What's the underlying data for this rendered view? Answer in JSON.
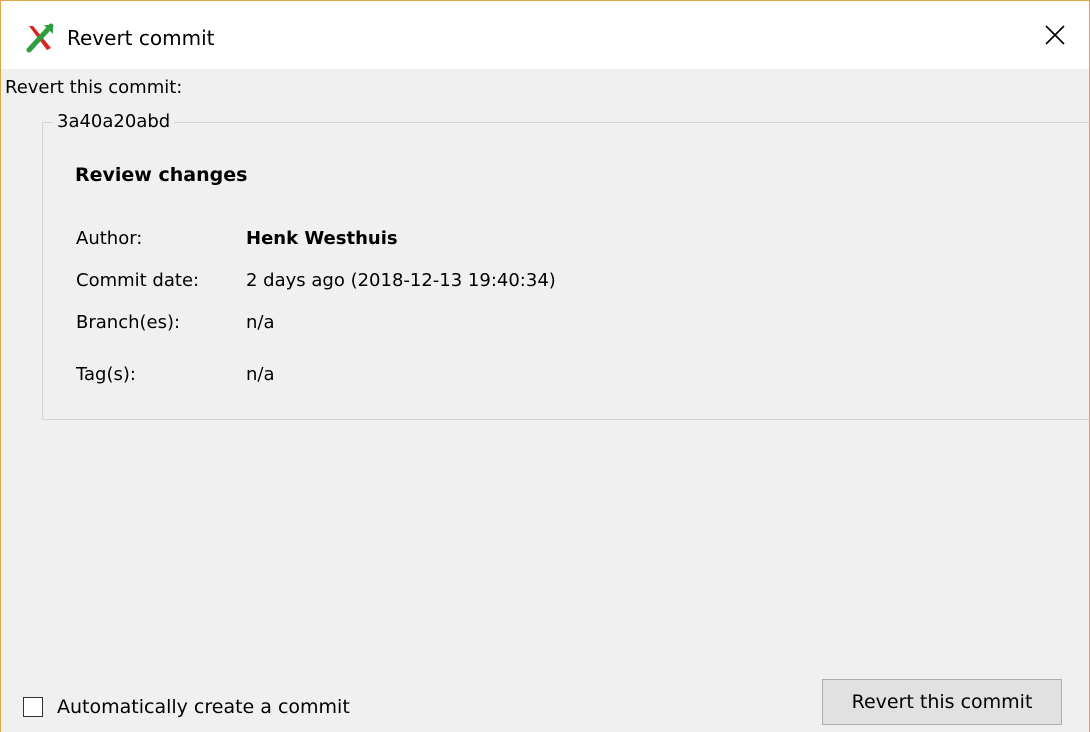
{
  "window": {
    "title": "Revert commit",
    "icon": "revert-x-icon",
    "close_icon": "close-icon"
  },
  "revert_label": "Revert this commit:",
  "commit": {
    "hash": "3a40a20abd",
    "heading": "Review changes",
    "fields": [
      {
        "label": "Author:",
        "value": "Henk Westhuis"
      },
      {
        "label": "Commit date:",
        "value": "2 days ago (2018-12-13 19:40:34)"
      },
      {
        "label": "Branch(es):",
        "value": "n/a"
      },
      {
        "label": "Tag(s):",
        "value": "n/a"
      }
    ]
  },
  "options": {
    "auto_commit_label": "Automatically create a commit",
    "auto_commit_checked": false
  },
  "buttons": {
    "revert_label": "Revert this commit"
  },
  "colors": {
    "window_background": "#f0f0f0",
    "titlebar_background": "#ffffff",
    "window_border": "#e0a44a",
    "icon_green": "#2e9e3e",
    "icon_red": "#d9261c",
    "button_background": "#e1e1e1"
  }
}
